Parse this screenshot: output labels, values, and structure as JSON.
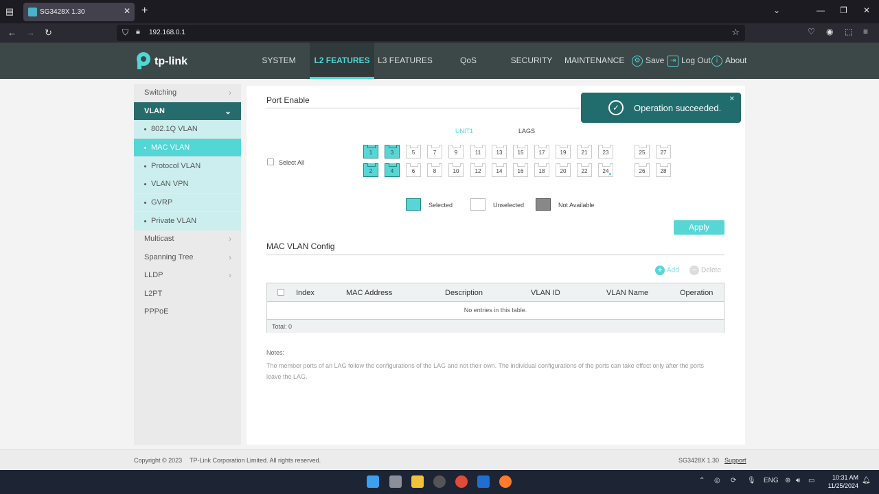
{
  "browser": {
    "tab_title": "SG3428X 1.30",
    "url": "192.168.0.1"
  },
  "header": {
    "logo_text": "tp-link",
    "menu": [
      "SYSTEM",
      "L2 FEATURES",
      "L3 FEATURES",
      "QoS",
      "SECURITY",
      "MAINTENANCE"
    ],
    "active_menu": "L2 FEATURES",
    "save": "Save",
    "logout": "Log Out",
    "about": "About"
  },
  "sidebar": {
    "switching": "Switching",
    "vlan": "VLAN",
    "vlan_sub": [
      "802.1Q VLAN",
      "MAC VLAN",
      "Protocol VLAN",
      "VLAN VPN",
      "GVRP",
      "Private VLAN"
    ],
    "active_sub": "MAC VLAN",
    "multicast": "Multicast",
    "spanning_tree": "Spanning Tree",
    "lldp": "LLDP",
    "l2pt": "L2PT",
    "pppoe": "PPPoE"
  },
  "port_enable": {
    "title": "Port Enable",
    "unit_label": "UNIT1",
    "lags_label": "LAGS",
    "select_all": "Select All",
    "top_row": [
      "1",
      "3",
      "5",
      "7",
      "9",
      "11",
      "13",
      "15",
      "17",
      "19",
      "21",
      "23"
    ],
    "bottom_row": [
      "2",
      "4",
      "6",
      "8",
      "10",
      "12",
      "14",
      "16",
      "18",
      "20",
      "22",
      "24"
    ],
    "lag_top": [
      "25",
      "27"
    ],
    "lag_bottom": [
      "26",
      "28"
    ],
    "selected_ports": [
      "1",
      "2",
      "3",
      "4"
    ],
    "legend_selected": "Selected",
    "legend_unselected": "Unselected",
    "legend_na": "Not Available",
    "apply": "Apply"
  },
  "mac_vlan": {
    "title": "MAC VLAN Config",
    "add": "Add",
    "delete": "Delete",
    "columns": [
      "Index",
      "MAC Address",
      "Description",
      "VLAN ID",
      "VLAN Name",
      "Operation"
    ],
    "empty": "No entries in this table.",
    "total": "Total: 0"
  },
  "notes": {
    "heading": "Notes:",
    "text": "The member ports of an LAG follow the configurations of the LAG and not their own. The individual configurations of the ports can take effect only after the ports leave the LAG."
  },
  "toast": {
    "message": "Operation succeeded."
  },
  "footer": {
    "copyright": "Copyright © 2023",
    "company": "TP-Link Corporation Limited. All rights reserved.",
    "model": "SG3428X 1.30",
    "support": "Support"
  },
  "taskbar": {
    "lang": "ENG",
    "time": "10:31 AM",
    "date": "11/25/2024"
  },
  "colors": {
    "accent": "#4fd6d6",
    "header_bg": "#3c4747",
    "toast_bg": "#216c6c"
  }
}
